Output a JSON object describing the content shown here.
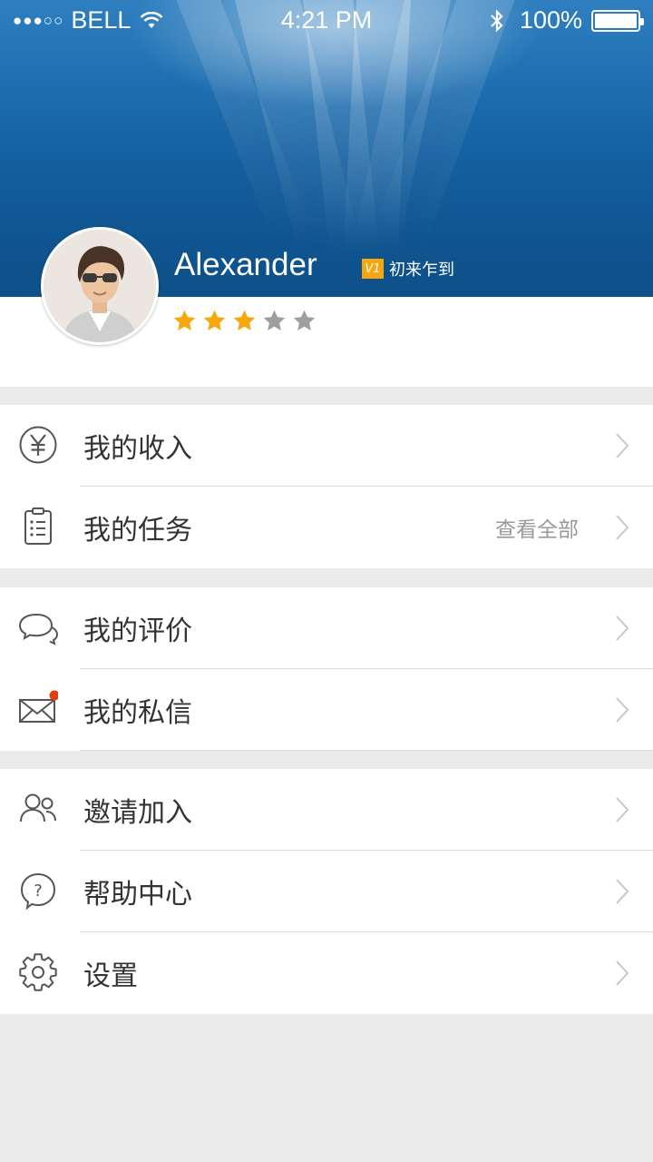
{
  "status_bar": {
    "signal_dots": "●●●○○",
    "carrier": "BELL",
    "time": "4:21 PM",
    "battery": "100%",
    "icons": [
      "wifi-icon",
      "bluetooth-icon",
      "battery-icon"
    ]
  },
  "profile": {
    "name": "Alexander",
    "level_badge": "V1",
    "level_title": "初来乍到",
    "rating": {
      "value": 3,
      "max": 5
    },
    "colors": {
      "star_on": "#f5a70d",
      "star_off": "#9e9e9e",
      "badge": "#f5a70d"
    }
  },
  "menu": {
    "group1": [
      {
        "label": "我的收入",
        "icon": "yuan-icon"
      },
      {
        "label": "我的任务",
        "icon": "clipboard-list-icon",
        "extra": "查看全部"
      }
    ],
    "group2": [
      {
        "label": "我的评价",
        "icon": "chat-bubbles-icon"
      },
      {
        "label": "我的私信",
        "icon": "envelope-icon",
        "has_unread_dot": true
      }
    ],
    "group3": [
      {
        "label": "邀请加入",
        "icon": "users-icon"
      },
      {
        "label": "帮助中心",
        "icon": "help-question-icon"
      },
      {
        "label": "设置",
        "icon": "gear-icon"
      }
    ],
    "colors": {
      "unread_dot": "#e0400b",
      "chevron": "#c8c8c8",
      "icon": "#555555"
    }
  }
}
